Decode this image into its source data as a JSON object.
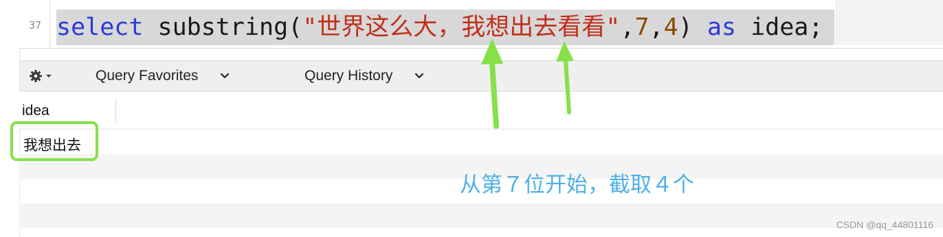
{
  "editor": {
    "line_number": "37",
    "code": {
      "kw_select": "select",
      "func_open": " substring(",
      "string_literal": "\"世界这么大，我想出去看看\"",
      "comma1": ",",
      "arg_start": "7",
      "comma2": ",",
      "arg_length": "4",
      "close_paren": ") ",
      "kw_as": "as",
      "alias": " idea;"
    }
  },
  "toolbar": {
    "gear_icon": "gear-icon",
    "query_favorites_label": "Query Favorites",
    "query_history_label": "Query History"
  },
  "results": {
    "columns": [
      "idea"
    ],
    "rows": [
      [
        "我想出去"
      ]
    ]
  },
  "annotation": {
    "text": "从第７位开始，截取４个",
    "arrow_color": "#86e04a",
    "text_color": "#4fb0e8"
  },
  "watermark": "CSDN @qq_44801116",
  "colors": {
    "keyword": "#2b3ad8",
    "string": "#c0301a",
    "number": "#8a4b00",
    "selection": "#d8d8d8"
  }
}
